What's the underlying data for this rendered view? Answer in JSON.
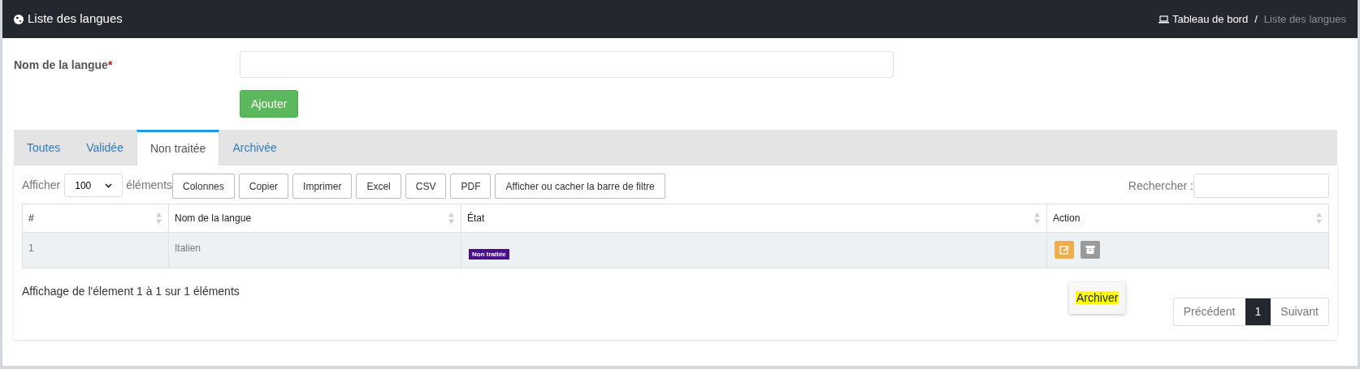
{
  "header": {
    "title": "Liste des langues",
    "breadcrumb": [
      {
        "label": "Tableau de bord",
        "current": false
      },
      {
        "label": "Liste des langues",
        "current": true
      }
    ],
    "separator": "/"
  },
  "form": {
    "label": "Nom de la langue",
    "required_mark": "*",
    "submit": "Ajouter"
  },
  "tabs": [
    {
      "label": "Toutes",
      "selected": false
    },
    {
      "label": "Validée",
      "selected": false
    },
    {
      "label": "Non traitée",
      "selected": true
    },
    {
      "label": "Archivée",
      "selected": false
    }
  ],
  "toolbar": {
    "show_label": "Afficher",
    "page_size": "100",
    "entries_label": "éléments",
    "buttons": [
      "Colonnes",
      "Copier",
      "Imprimer",
      "Excel",
      "CSV",
      "PDF",
      "Afficher ou cacher la barre de filtre"
    ],
    "search_label": "Rechercher :"
  },
  "table": {
    "columns": [
      "#",
      "Nom de la langue",
      "État",
      "Action"
    ],
    "rows": [
      {
        "number": "1",
        "name": "Italien",
        "state": "Non traitée"
      }
    ]
  },
  "tooltip": "Archiver",
  "info": "Affichage de l'élement 1 à 1 sur 1 éléments",
  "pagination": [
    {
      "label": "Précédent",
      "selected": false
    },
    {
      "label": "1",
      "selected": true
    },
    {
      "label": "Suivant",
      "selected": false
    }
  ]
}
